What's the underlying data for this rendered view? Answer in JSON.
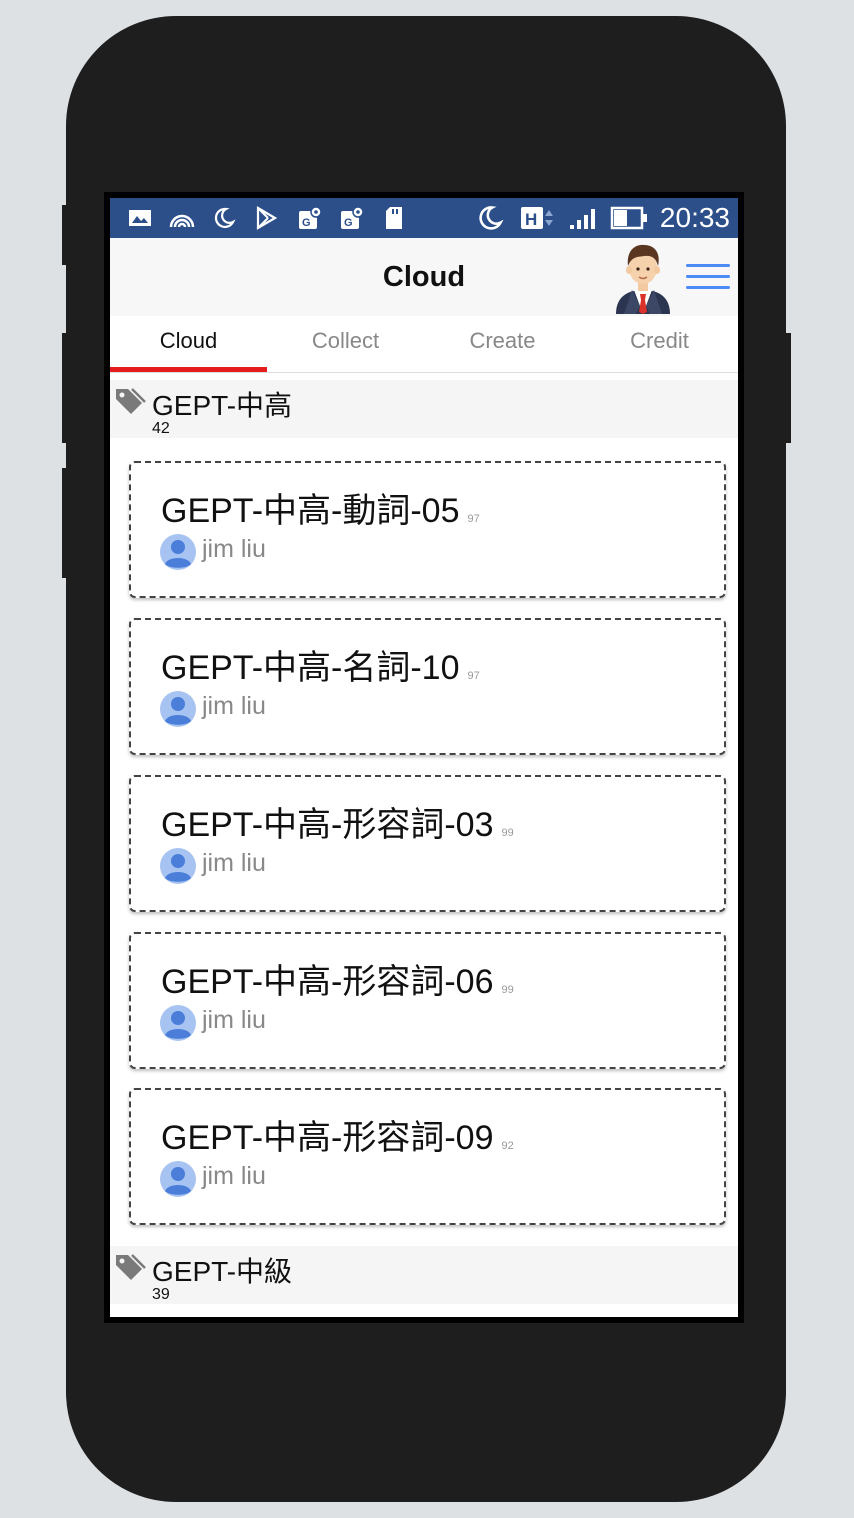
{
  "status_bar": {
    "time": "20:33",
    "icons": [
      "image-icon",
      "hotspot-icon",
      "moon-icon",
      "play-store-icon",
      "maps-icon",
      "maps-icon",
      "sd-card-icon",
      "moon-icon",
      "h-network-icon",
      "signal-icon",
      "battery-icon"
    ]
  },
  "app_bar": {
    "title": "Cloud"
  },
  "tabs": [
    {
      "label": "Cloud",
      "active": true
    },
    {
      "label": "Collect",
      "active": false
    },
    {
      "label": "Create",
      "active": false
    },
    {
      "label": "Credit",
      "active": false
    }
  ],
  "sections": [
    {
      "title": "GEPT-中高",
      "count": "42",
      "cards": [
        {
          "title": "GEPT-中高-動詞-05",
          "number": "97",
          "author": "jim liu"
        },
        {
          "title": "GEPT-中高-名詞-10",
          "number": "97",
          "author": "jim liu"
        },
        {
          "title": "GEPT-中高-形容詞-03",
          "number": "99",
          "author": "jim liu"
        },
        {
          "title": "GEPT-中高-形容詞-06",
          "number": "99",
          "author": "jim liu"
        },
        {
          "title": "GEPT-中高-形容詞-09",
          "number": "92",
          "author": "jim liu"
        }
      ]
    },
    {
      "title": "GEPT-中級",
      "count": "39",
      "cards": []
    }
  ],
  "colors": {
    "status_bar": "#2c4f8a",
    "tab_indicator": "#e41d1d",
    "menu_icon": "#4a8bf5",
    "user_icon": "#6d9be8"
  }
}
